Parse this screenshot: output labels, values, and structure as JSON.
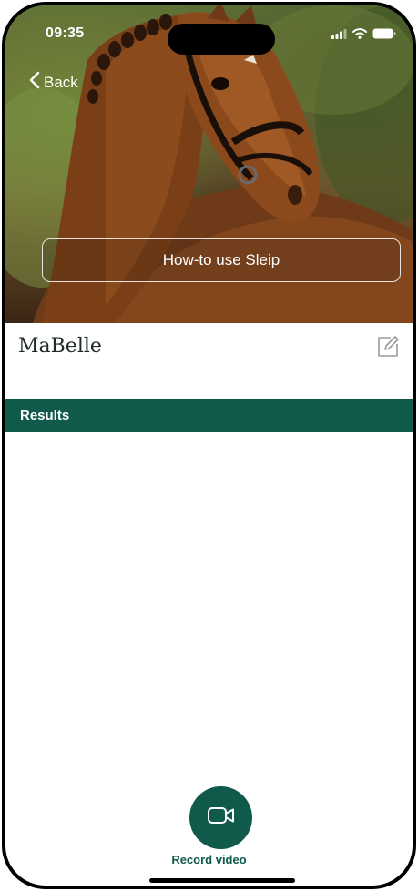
{
  "status_bar": {
    "time": "09:35",
    "icons": [
      "cellular-signal-icon",
      "wifi-icon",
      "battery-icon"
    ]
  },
  "nav": {
    "back_label": "Back",
    "back_icon": "chevron-left-icon"
  },
  "hero": {
    "image": "horse-portrait-photo",
    "howto_label": "How-to use Sleip"
  },
  "horse": {
    "name": "MaBelle",
    "edit_icon": "edit-icon"
  },
  "results": {
    "title": "Results"
  },
  "record": {
    "label": "Record video",
    "icon": "video-camera-icon"
  },
  "colors": {
    "brand_green": "#0f5a4b",
    "name_text": "#1f2b26",
    "overlay_text": "#ffffff"
  }
}
